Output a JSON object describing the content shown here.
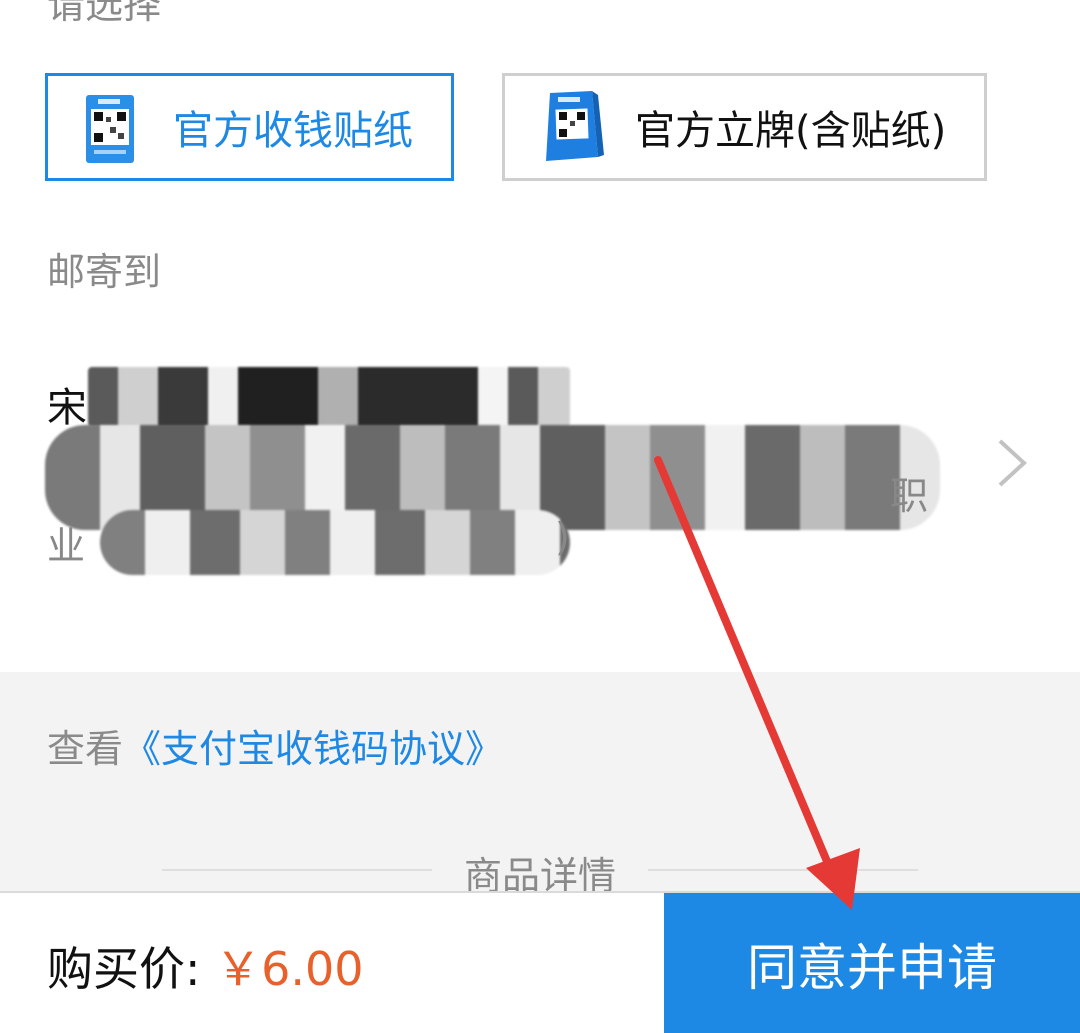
{
  "header": {
    "choose_label": "请选择"
  },
  "options": [
    {
      "label": "官方收钱贴纸",
      "selected": true
    },
    {
      "label": "官方立牌(含贴纸)",
      "selected": false
    }
  ],
  "mail": {
    "label": "邮寄到",
    "name_visible": "宋",
    "address_tail_1": "职",
    "address_tail_2": "业",
    "address_tail_3": ")"
  },
  "agreement": {
    "prefix": "查看",
    "link": "《支付宝收钱码协议》"
  },
  "details": {
    "title": "商品详情"
  },
  "bottom_bar": {
    "price_label": "购买价: ",
    "price_value": "￥6.00",
    "apply_label": "同意并申请"
  },
  "colors": {
    "accent": "#1e88e5",
    "price": "#e8602a",
    "annotation_arrow": "#e53935"
  }
}
